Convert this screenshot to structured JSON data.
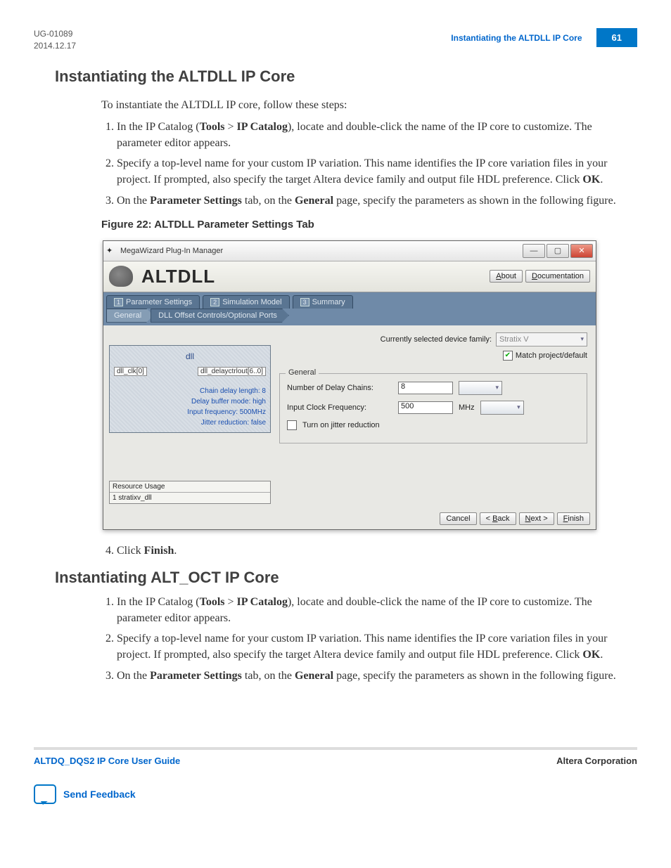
{
  "header": {
    "doc_id": "UG-01089",
    "date": "2014.12.17",
    "crumb": "Instantiating the ALTDLL IP Core",
    "page": "61"
  },
  "section1": {
    "title": "Instantiating the ALTDLL IP Core",
    "intro": "To instantiate the ALTDLL IP core, follow these steps:",
    "steps": {
      "s1_a": "In the IP Catalog (",
      "s1_b": "Tools",
      "s1_c": " > ",
      "s1_d": "IP Catalog",
      "s1_e": "), locate and double-click the name of the IP core to customize. The parameter editor appears.",
      "s2_a": "Specify a top-level name for your custom IP variation. This name identifies the IP core variation files in your project. If prompted, also specify the target Altera device family and output file HDL preference. Click ",
      "s2_b": "OK",
      "s2_c": ".",
      "s3_a": "On the ",
      "s3_b": "Parameter Settings",
      "s3_c": " tab, on the ",
      "s3_d": "General",
      "s3_e": " page, specify the parameters as shown in the following figure.",
      "s4_a": "Click ",
      "s4_b": "Finish",
      "s4_c": "."
    },
    "figure_caption": "Figure 22: ALTDLL Parameter Settings Tab"
  },
  "screenshot": {
    "window_title": "MegaWizard Plug-In Manager",
    "brand": "ALTDLL",
    "about_btn": "About",
    "doc_btn": "Documentation",
    "tabs": {
      "t1": "Parameter Settings",
      "t2": "Simulation Model",
      "t3": "Summary"
    },
    "subtabs": {
      "general": "General",
      "offset": "DLL Offset Controls/Optional Ports"
    },
    "block": {
      "name": "dll",
      "pin_left": "dll_clk[0]",
      "pin_right": "dll_delayctrlout[6..0]",
      "p1": "Chain delay length: 8",
      "p2": "Delay buffer mode: high",
      "p3": "Input frequency: 500MHz",
      "p4": "Jitter reduction: false"
    },
    "resource": {
      "header": "Resource Usage",
      "body": "1 stratixv_dll"
    },
    "right": {
      "dev_label": "Currently selected device family:",
      "dev_value": "Stratix V",
      "match_label": "Match project/default",
      "group": "General",
      "row1_label": "Number of Delay Chains:",
      "row1_value": "8",
      "row2_label": "Input Clock Frequency:",
      "row2_value": "500",
      "row2_unit": "MHz",
      "row3_label": "Turn on jitter reduction"
    },
    "footer_buttons": {
      "cancel": "Cancel",
      "back": "< Back",
      "next": "Next >",
      "finish": "Finish"
    }
  },
  "section2": {
    "title": "Instantiating ALT_OCT IP Core",
    "steps": {
      "s1_a": "In the IP Catalog (",
      "s1_b": "Tools",
      "s1_c": " > ",
      "s1_d": "IP Catalog",
      "s1_e": "), locate and double-click the name of the IP core to customize. The parameter editor appears.",
      "s2_a": "Specify a top-level name for your custom IP variation. This name identifies the IP core variation files in your project. If prompted, also specify the target Altera device family and output file HDL preference. Click ",
      "s2_b": "OK",
      "s2_c": ".",
      "s3_a": "On the ",
      "s3_b": "Parameter Settings",
      "s3_c": " tab, on the ",
      "s3_d": "General",
      "s3_e": " page, specify the parameters as shown in the following figure."
    }
  },
  "footer": {
    "left": "ALTDQ_DQS2 IP Core User Guide",
    "right": "Altera Corporation",
    "feedback": "Send Feedback"
  }
}
